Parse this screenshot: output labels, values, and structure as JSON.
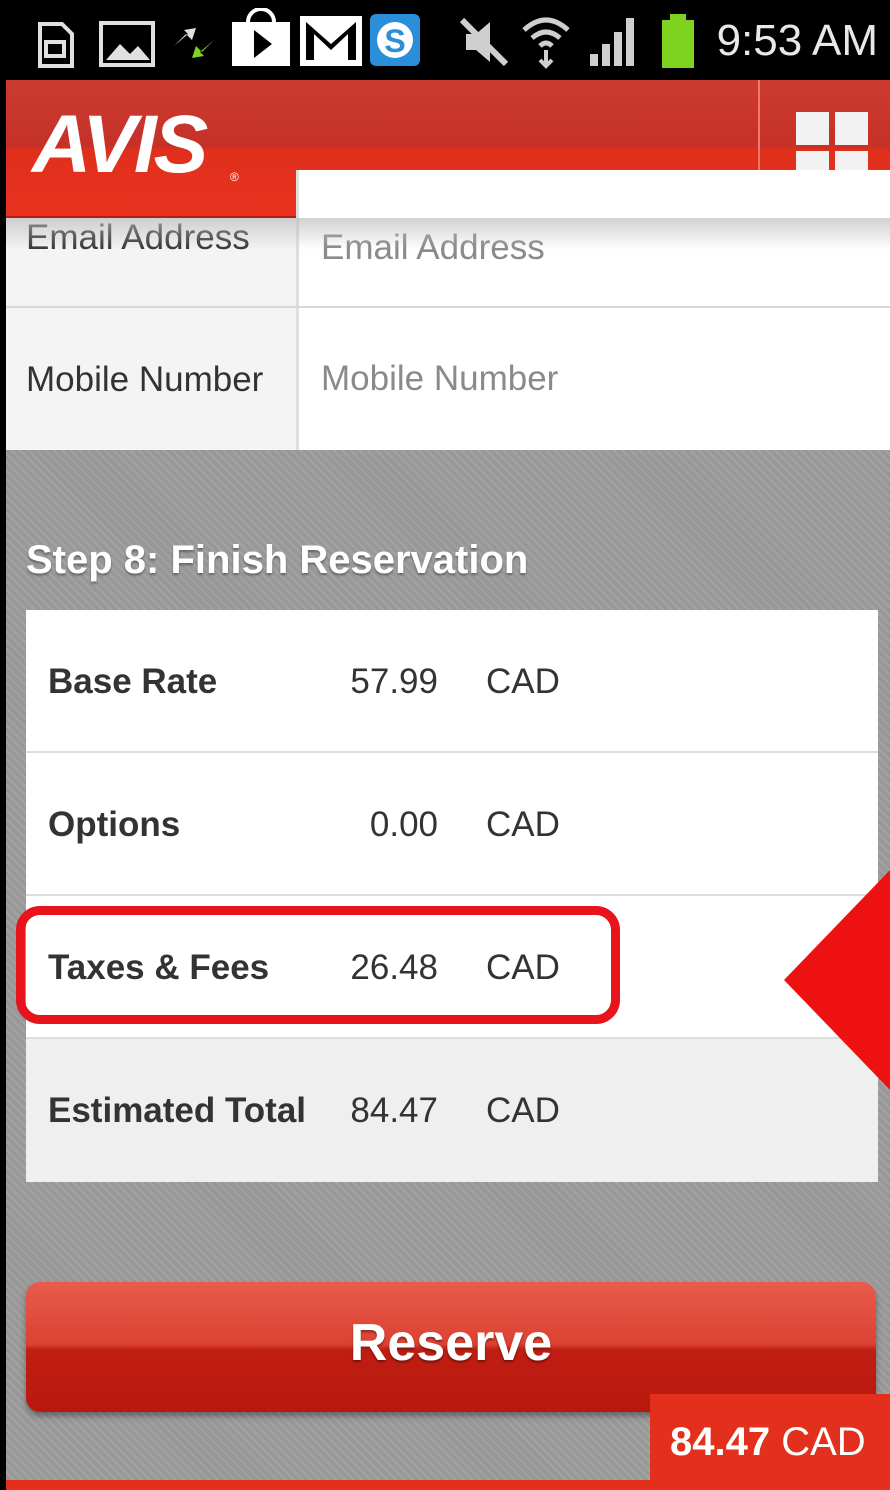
{
  "status_bar": {
    "time": "9:53 AM",
    "icons": [
      "sd-card-icon",
      "gallery-icon",
      "sync-icon",
      "play-store-icon",
      "gmail-icon",
      "skype-icon",
      "mute-icon",
      "wifi-icon",
      "signal-icon",
      "battery-icon"
    ],
    "battery_color": "#7ed321"
  },
  "header": {
    "logo": "AVIS",
    "menu_icon": "grid-menu-icon",
    "brand_color": "#d9261c"
  },
  "form": {
    "email_label": "Email Address",
    "email_placeholder": "Email Address",
    "mobile_label": "Mobile Number",
    "mobile_placeholder": "Mobile Number"
  },
  "summary": {
    "title": "Step 8: Finish Reservation",
    "rows": [
      {
        "label": "Base Rate",
        "amount": "57.99",
        "currency": "CAD"
      },
      {
        "label": "Options",
        "amount": "0.00",
        "currency": "CAD"
      },
      {
        "label": "Taxes & Fees",
        "amount": "26.48",
        "currency": "CAD"
      },
      {
        "label": "Estimated Total",
        "amount": "84.47",
        "currency": "CAD"
      }
    ],
    "highlight_color": "#e8131b"
  },
  "actions": {
    "reserve_label": "Reserve"
  },
  "footer": {
    "total_amount": "84.47",
    "total_currency": "CAD"
  }
}
